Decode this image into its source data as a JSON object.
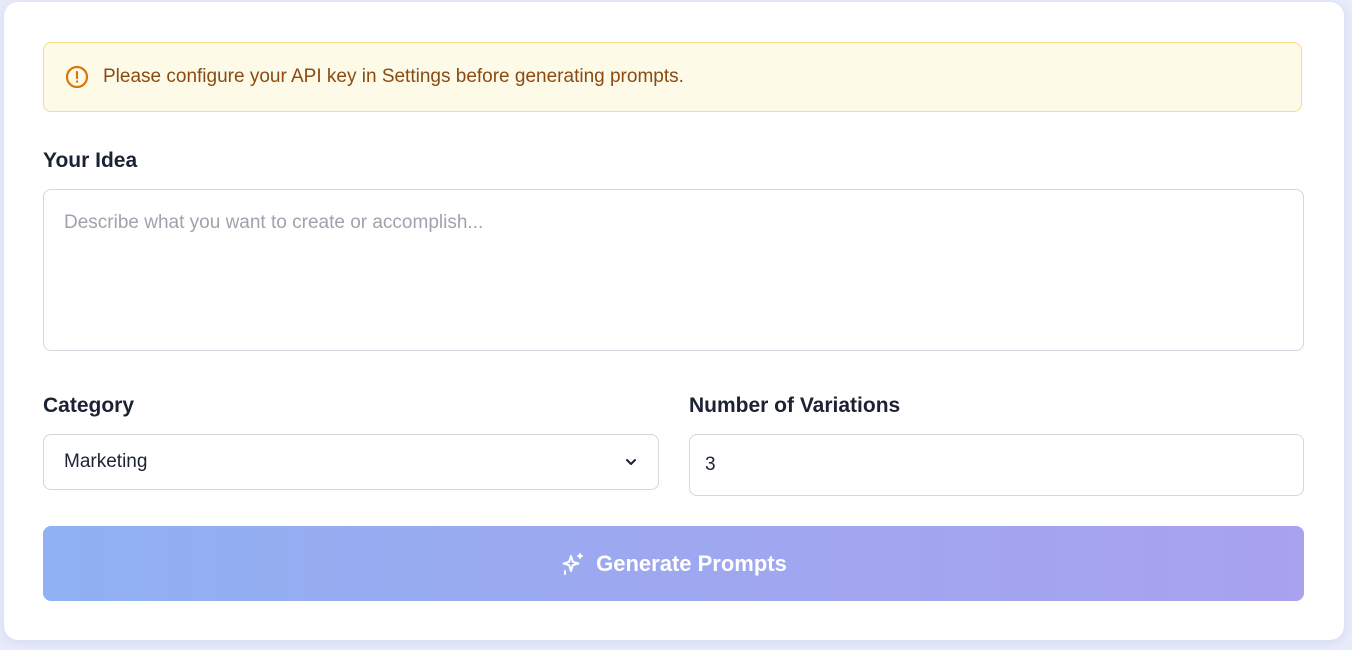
{
  "alert": {
    "message": "Please configure your API key in Settings before generating prompts.",
    "icon": "alert-circle-icon",
    "color": "#d97706"
  },
  "idea": {
    "label": "Your Idea",
    "placeholder": "Describe what you want to create or accomplish...",
    "value": ""
  },
  "category": {
    "label": "Category",
    "selected": "Marketing"
  },
  "variations": {
    "label": "Number of Variations",
    "value": "3"
  },
  "generate": {
    "label": "Generate Prompts",
    "icon": "sparkles-icon"
  },
  "colors": {
    "accent_start": "#90b1f4",
    "accent_end": "#a9a2ee",
    "alert_bg": "#fefae8",
    "alert_text": "#8a4a12"
  }
}
